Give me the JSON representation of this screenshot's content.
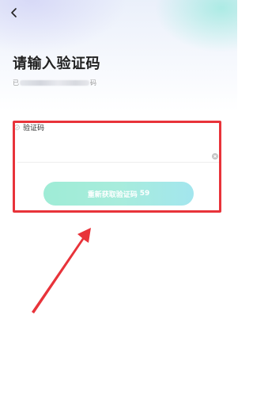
{
  "header": {
    "back_icon": "chevron-left-icon"
  },
  "page": {
    "title": "请输入验证码",
    "sent_prefix": "已",
    "sent_suffix": "码"
  },
  "form": {
    "code_label": "验证码",
    "code_value": "",
    "clear_icon": "clear-circle-icon"
  },
  "resend_button": {
    "label": "重新获取验证码",
    "countdown": "59"
  },
  "colors": {
    "annotation": "#e8333a",
    "button_gradient_start": "#9fecd6",
    "button_gradient_end": "#a3e6ee"
  }
}
